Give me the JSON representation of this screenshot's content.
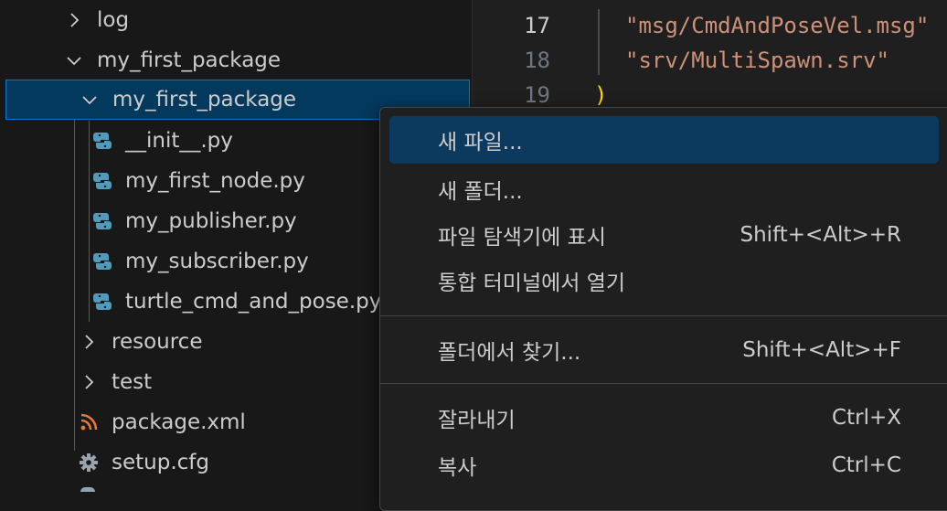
{
  "explorer": {
    "items": [
      {
        "label": "log",
        "kind": "folder",
        "expanded": false
      },
      {
        "label": "my_first_package",
        "kind": "folder",
        "expanded": true
      },
      {
        "label": "my_first_package",
        "kind": "folder",
        "expanded": true,
        "selected": true
      },
      {
        "label": "__init__.py",
        "kind": "python"
      },
      {
        "label": "my_first_node.py",
        "kind": "python"
      },
      {
        "label": "my_publisher.py",
        "kind": "python"
      },
      {
        "label": "my_subscriber.py",
        "kind": "python"
      },
      {
        "label": "turtle_cmd_and_pose.py",
        "kind": "python"
      },
      {
        "label": "resource",
        "kind": "folder",
        "expanded": false
      },
      {
        "label": "test",
        "kind": "folder",
        "expanded": false
      },
      {
        "label": "package.xml",
        "kind": "xml"
      },
      {
        "label": "setup.cfg",
        "kind": "config"
      }
    ]
  },
  "editor": {
    "lines": [
      {
        "num": "17",
        "text": "\"msg/CmdAndPoseVel.msg\""
      },
      {
        "num": "18",
        "text": "\"srv/MultiSpawn.srv\""
      },
      {
        "num": "19",
        "text": ")"
      }
    ]
  },
  "context_menu": {
    "items": [
      {
        "label": "새 파일...",
        "shortcut": ""
      },
      {
        "label": "새 폴더...",
        "shortcut": ""
      },
      {
        "label": "파일 탐색기에 표시",
        "shortcut": "Shift+<Alt>+R"
      },
      {
        "label": "통합 터미널에서 열기",
        "shortcut": ""
      },
      {
        "label": "폴더에서 찾기...",
        "shortcut": "Shift+<Alt>+F"
      },
      {
        "label": "잘라내기",
        "shortcut": "Ctrl+X"
      },
      {
        "label": "복사",
        "shortcut": "Ctrl+C"
      }
    ]
  },
  "colors": {
    "selection_bg": "#04395e",
    "selection_border": "#0078d4",
    "menu_highlight": "#0b3a5e",
    "string": "#ce9178",
    "python_icon": "#519aba",
    "xml_icon": "#e37933"
  }
}
